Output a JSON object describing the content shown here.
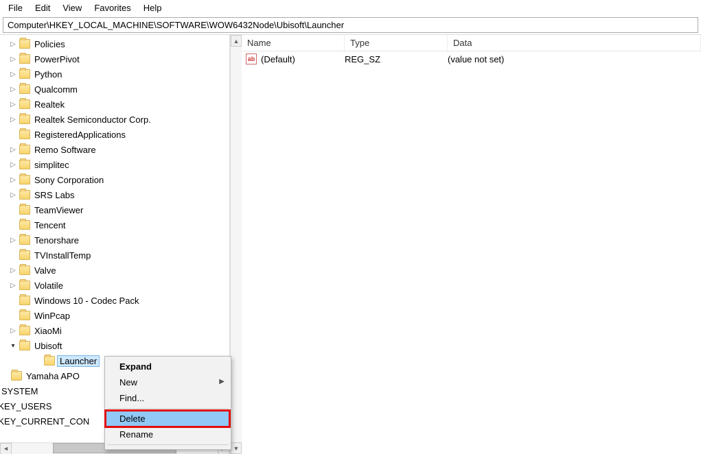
{
  "menu": {
    "items": [
      "File",
      "Edit",
      "View",
      "Favorites",
      "Help"
    ]
  },
  "address": "Computer\\HKEY_LOCAL_MACHINE\\SOFTWARE\\WOW6432Node\\Ubisoft\\Launcher",
  "tree": [
    {
      "label": "Policies",
      "depth": 0,
      "exp": "closed"
    },
    {
      "label": "PowerPivot",
      "depth": 0,
      "exp": "closed"
    },
    {
      "label": "Python",
      "depth": 0,
      "exp": "closed"
    },
    {
      "label": "Qualcomm",
      "depth": 0,
      "exp": "closed"
    },
    {
      "label": "Realtek",
      "depth": 0,
      "exp": "closed"
    },
    {
      "label": "Realtek Semiconductor Corp.",
      "depth": 0,
      "exp": "closed"
    },
    {
      "label": "RegisteredApplications",
      "depth": 0,
      "exp": "none"
    },
    {
      "label": "Remo Software",
      "depth": 0,
      "exp": "closed"
    },
    {
      "label": "simplitec",
      "depth": 0,
      "exp": "closed"
    },
    {
      "label": "Sony Corporation",
      "depth": 0,
      "exp": "closed"
    },
    {
      "label": "SRS Labs",
      "depth": 0,
      "exp": "closed"
    },
    {
      "label": "TeamViewer",
      "depth": 0,
      "exp": "none"
    },
    {
      "label": "Tencent",
      "depth": 0,
      "exp": "none"
    },
    {
      "label": "Tenorshare",
      "depth": 0,
      "exp": "closed"
    },
    {
      "label": "TVInstallTemp",
      "depth": 0,
      "exp": "none"
    },
    {
      "label": "Valve",
      "depth": 0,
      "exp": "closed"
    },
    {
      "label": "Volatile",
      "depth": 0,
      "exp": "closed"
    },
    {
      "label": "Windows 10 - Codec Pack",
      "depth": 0,
      "exp": "none"
    },
    {
      "label": "WinPcap",
      "depth": 0,
      "exp": "none"
    },
    {
      "label": "XiaoMi",
      "depth": 0,
      "exp": "closed"
    },
    {
      "label": "Ubisoft",
      "depth": 0,
      "exp": "open"
    },
    {
      "label": "Launcher",
      "depth": 1,
      "exp": "none",
      "selected": true
    },
    {
      "label": "Yamaha APO",
      "depth": -1,
      "exp": "none"
    },
    {
      "label": "SYSTEM",
      "depth": -2,
      "exp": "none",
      "nofolder": true
    },
    {
      "label": "HKEY_USERS",
      "depth": -3,
      "exp": "none",
      "nofolder": true
    },
    {
      "label": "HKEY_CURRENT_CON",
      "depth": -3,
      "exp": "none",
      "nofolder": true,
      "clip": true
    }
  ],
  "list": {
    "headers": {
      "name": "Name",
      "type": "Type",
      "data": "Data"
    },
    "rows": [
      {
        "name": "(Default)",
        "type": "REG_SZ",
        "data": "(value not set)"
      }
    ]
  },
  "ctx": {
    "items": [
      {
        "label": "Expand",
        "bold": true
      },
      {
        "label": "New",
        "submenu": true
      },
      {
        "label": "Find...",
        "sepAfter": true
      },
      {
        "label": "Delete",
        "highlight": true
      },
      {
        "label": "Rename",
        "sepAfter": true
      }
    ]
  }
}
